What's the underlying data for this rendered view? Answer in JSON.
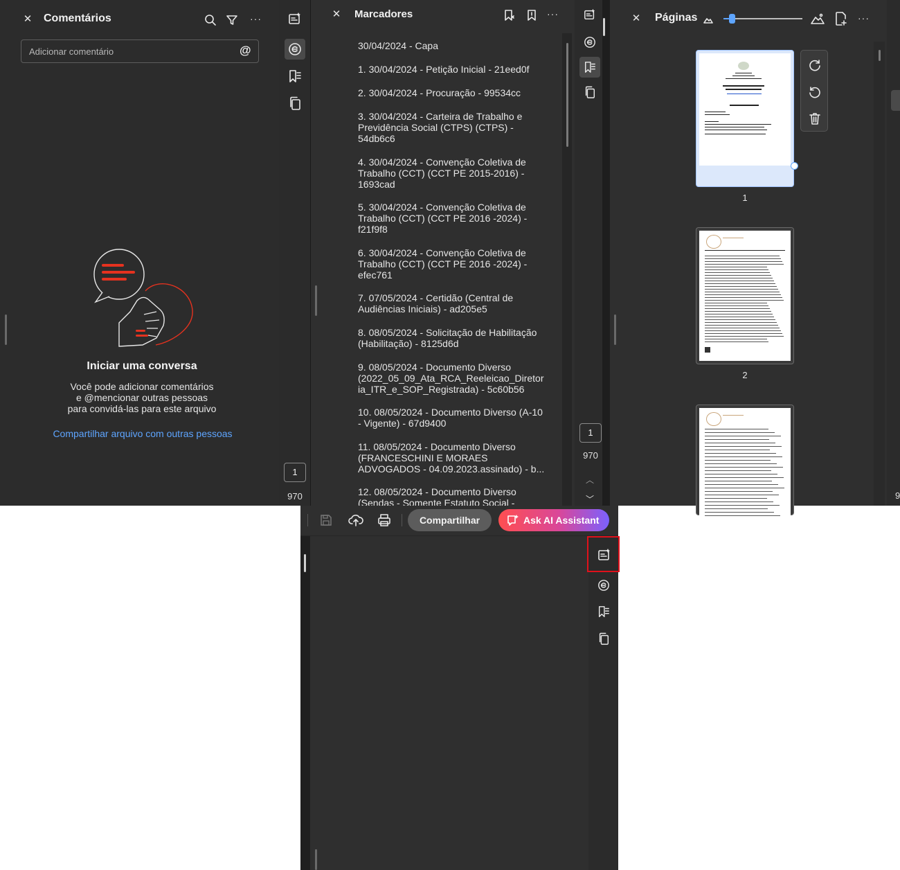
{
  "comments_panel": {
    "title": "Comentários",
    "input_placeholder": "Adicionar comentário",
    "mention_symbol": "@",
    "empty_title": "Iniciar uma conversa",
    "empty_desc_1": "Você pode adicionar comentários",
    "empty_desc_2": "e @mencionar outras pessoas",
    "empty_desc_3": "para convidá-las para este arquivo",
    "share_link": "Compartilhar arquivo com outras pessoas",
    "page_current": "1",
    "page_total": "970"
  },
  "bookmarks_panel": {
    "title": "Marcadores",
    "items": [
      "30/04/2024 - Capa",
      "1. 30/04/2024 - Petição Inicial - 21eed0f",
      "2. 30/04/2024 - Procuração - 99534cc",
      "3. 30/04/2024 - Carteira de Trabalho e Previdência Social (CTPS) (CTPS) - 54db6c6",
      "4. 30/04/2024 - Convenção Coletiva de Trabalho (CCT) (CCT PE 2015-2016) - 1693cad",
      "5. 30/04/2024 - Convenção Coletiva de Trabalho (CCT) (CCT PE 2016 -2024) - f21f9f8",
      "6. 30/04/2024 - Convenção Coletiva de Trabalho (CCT) (CCT PE 2016 -2024) - efec761",
      "7. 07/05/2024 - Certidão (Central de Audiências Iniciais) - ad205e5",
      "8. 08/05/2024 - Solicitação de Habilitação (Habilitação) - 8125d6d",
      "9. 08/05/2024 - Documento Diverso (2022_05_09_Ata_RCA_Reeleicao_Diretoria_ITR_e_SOP_Registrada) - 5c60b56",
      "10. 08/05/2024 - Documento Diverso (A-10 - Vigente) - 67d9400",
      "11. 08/05/2024 - Documento Diverso (FRANCESCHINI E MORAES ADVOGADOS - 04.09.2023.assinado) - b...",
      "12. 08/05/2024 - Documento Diverso (Sendas - Somente Estatuto Social -"
    ],
    "page_current": "1",
    "page_total": "970"
  },
  "pages_panel": {
    "title": "Páginas",
    "zoom_level": 0.1,
    "thumb_labels": [
      "1",
      "2"
    ],
    "page_current": "1",
    "page_total": "9"
  },
  "toolbar": {
    "share_label": "Compartilhar",
    "ai_label": "Ask AI Assistant"
  },
  "colors": {
    "panel_bg": "#2f2f2f",
    "accent_red": "#e5321f",
    "link_blue": "#5ea5ff",
    "ai_gradient_start": "#ff4e50",
    "ai_gradient_end": "#7b61ff",
    "highlight_box": "#e0111b"
  }
}
